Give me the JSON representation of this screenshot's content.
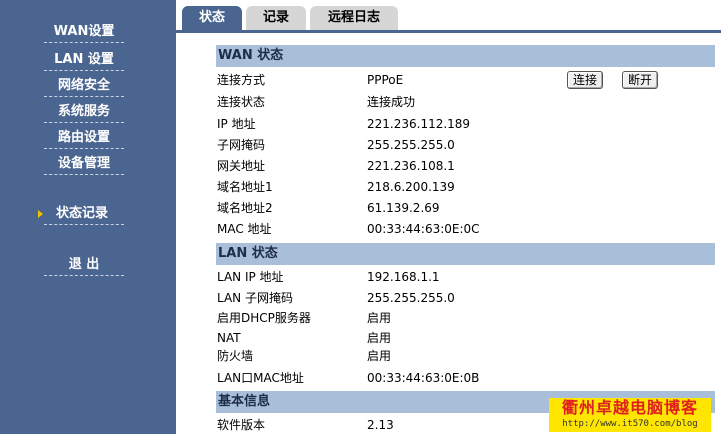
{
  "colors": {
    "sidebar_bg": "#4b6591",
    "section_header_bg": "#a9bed8",
    "tab_inactive_bg": "#d6d6d6",
    "watermark_bg": "#ffe600",
    "watermark_text": "#e02020"
  },
  "sidebar": {
    "items": [
      {
        "label": "WAN设置"
      },
      {
        "label": "LAN 设置"
      },
      {
        "label": "网络安全"
      },
      {
        "label": "系统服务"
      },
      {
        "label": "路由设置"
      },
      {
        "label": "设备管理"
      },
      {
        "label": "状态记录",
        "active": true
      },
      {
        "label": "退 出"
      }
    ]
  },
  "tabs": [
    {
      "label": "状态",
      "active": true
    },
    {
      "label": "记录"
    },
    {
      "label": "远程日志"
    }
  ],
  "wan": {
    "title": "WAN 状态",
    "connect_button": "连接",
    "disconnect_button": "断开",
    "rows": [
      {
        "label": "连接方式",
        "value": "PPPoE"
      },
      {
        "label": "连接状态",
        "value": "连接成功"
      },
      {
        "label": "IP 地址",
        "value": "221.236.112.189"
      },
      {
        "label": "子网掩码",
        "value": "255.255.255.0"
      },
      {
        "label": "网关地址",
        "value": "221.236.108.1"
      },
      {
        "label": "域名地址1",
        "value": "218.6.200.139"
      },
      {
        "label": "域名地址2",
        "value": "61.139.2.69"
      },
      {
        "label": "MAC 地址",
        "value": "00:33:44:63:0E:0C"
      }
    ]
  },
  "lan": {
    "title": "LAN 状态",
    "rows": [
      {
        "label": "LAN IP 地址",
        "value": "192.168.1.1"
      },
      {
        "label": "LAN 子网掩码",
        "value": "255.255.255.0"
      },
      {
        "label": "启用DHCP服务器",
        "value": "启用"
      },
      {
        "label": "NAT",
        "value": "启用"
      },
      {
        "label": "防火墙",
        "value": "启用"
      },
      {
        "label": "LAN口MAC地址",
        "value": "00:33:44:63:0E:0B"
      }
    ]
  },
  "basic": {
    "title": "基本信息",
    "rows": [
      {
        "label": "软件版本",
        "value": "2.13"
      }
    ]
  },
  "watermark": {
    "title": "衢州卓越电脑博客",
    "url": "http://www.it570.com/blog"
  }
}
